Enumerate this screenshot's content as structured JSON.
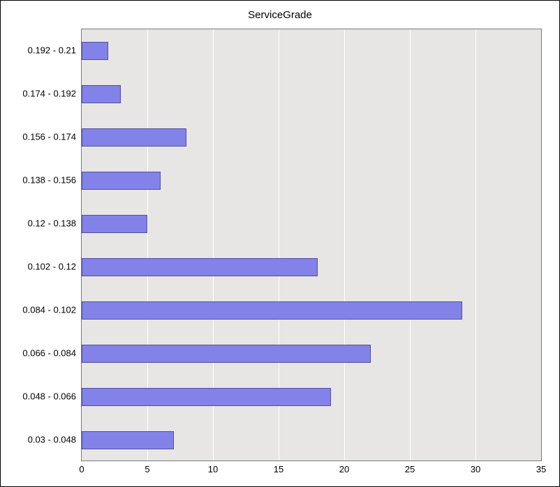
{
  "chart_data": {
    "type": "bar",
    "title": "ServiceGrade",
    "orientation": "horizontal",
    "xlabel": "",
    "ylabel": "",
    "xlim": [
      0,
      35
    ],
    "x_ticks": [
      0,
      5,
      10,
      15,
      20,
      25,
      30,
      35
    ],
    "categories": [
      "0.192 - 0.21",
      "0.174 - 0.192",
      "0.156 - 0.174",
      "0.138 - 0.156",
      "0.12 - 0.138",
      "0.102 - 0.12",
      "0.084 - 0.102",
      "0.066 - 0.084",
      "0.048 - 0.066",
      "0.03 - 0.048"
    ],
    "values": [
      2,
      3,
      8,
      6,
      5,
      18,
      29,
      22,
      19,
      7
    ],
    "bar_fill": "#8282e8",
    "bar_stroke": "#514fa0",
    "plot_bg": "#e7e6e4"
  }
}
